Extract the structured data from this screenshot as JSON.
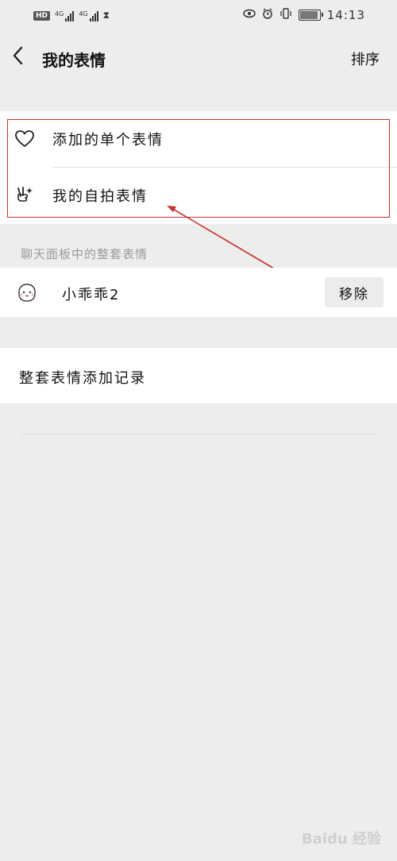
{
  "status_bar": {
    "hd_badge": "HD",
    "network_1": "4G",
    "network_2": "4G",
    "time": "14:13",
    "icons": [
      "eye-icon",
      "alarm-icon",
      "vibrate-icon",
      "battery-icon"
    ]
  },
  "nav": {
    "back_icon": "chevron-left-icon",
    "title": "我的表情",
    "sort_label": "排序"
  },
  "menu": {
    "items": [
      {
        "label": "添加的单个表情",
        "icon": "heart-icon"
      },
      {
        "label": "我的自拍表情",
        "icon": "selfie-victory-icon"
      }
    ]
  },
  "highlight": {
    "color": "#c4332b"
  },
  "section": {
    "title": "聊天面板中的整套表情"
  },
  "packs": [
    {
      "name": "小乖乖2",
      "action_label": "移除",
      "avatar_icon": "sticker-avatar-icon"
    }
  ],
  "records": {
    "label": "整套表情添加记录"
  },
  "watermark": {
    "text": "Baidu 经验"
  }
}
